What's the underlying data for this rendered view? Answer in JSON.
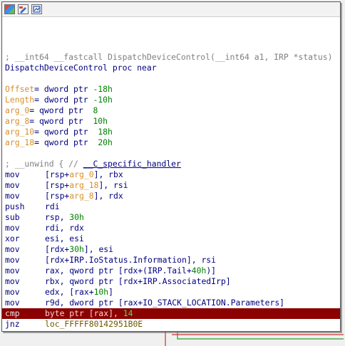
{
  "titlebar": {
    "icons": [
      "color-palette-icon",
      "edit-node-icon",
      "graph-overview-icon"
    ]
  },
  "header": {
    "comment": "; __int64 __fastcall DispatchDeviceControl(__int64 a1, IRP *status)",
    "proc_name": "DispatchDeviceControl",
    "proc_kw": " proc near"
  },
  "vars": [
    {
      "name": "Offset",
      "type": "= dword ptr ",
      "value": "-18h"
    },
    {
      "name": "Length",
      "type": "= dword ptr ",
      "value": "-10h"
    },
    {
      "name": "arg_0",
      "type": "= qword ptr  ",
      "value": "8"
    },
    {
      "name": "arg_8",
      "type": "= qword ptr  ",
      "value": "10h"
    },
    {
      "name": "arg_10",
      "type": "= qword ptr  ",
      "value": "18h"
    },
    {
      "name": "arg_18",
      "type": "= qword ptr  ",
      "value": "20h"
    }
  ],
  "unwind": {
    "prefix": "; __unwind { // ",
    "handler": "__C_specific_handler"
  },
  "instructions": [
    {
      "mn": "mov",
      "parts": [
        [
          "[rsp+",
          "kw"
        ],
        [
          "arg_0",
          "var"
        ],
        [
          "], rbx",
          "kw"
        ]
      ]
    },
    {
      "mn": "mov",
      "parts": [
        [
          "[rsp+",
          "kw"
        ],
        [
          "arg_18",
          "var"
        ],
        [
          "], rsi",
          "kw"
        ]
      ]
    },
    {
      "mn": "mov",
      "parts": [
        [
          "[rsp+",
          "kw"
        ],
        [
          "arg_8",
          "var"
        ],
        [
          "], rdx",
          "kw"
        ]
      ]
    },
    {
      "mn": "push",
      "parts": [
        [
          "rdi",
          "kw"
        ]
      ]
    },
    {
      "mn": "sub",
      "parts": [
        [
          "rsp, ",
          "kw"
        ],
        [
          "30h",
          "num"
        ]
      ]
    },
    {
      "mn": "mov",
      "parts": [
        [
          "rdi, rdx",
          "kw"
        ]
      ]
    },
    {
      "mn": "xor",
      "parts": [
        [
          "esi, esi",
          "kw"
        ]
      ]
    },
    {
      "mn": "mov",
      "parts": [
        [
          "[rdx+",
          "kw"
        ],
        [
          "30h",
          "num"
        ],
        [
          "], esi",
          "kw"
        ]
      ]
    },
    {
      "mn": "mov",
      "parts": [
        [
          "[rdx+IRP.IoStatus.Information], rsi",
          "kw"
        ]
      ]
    },
    {
      "mn": "mov",
      "parts": [
        [
          "rax, qword ptr [rdx+(IRP.Tail+",
          "kw"
        ],
        [
          "40h",
          "num"
        ],
        [
          ")]",
          "kw"
        ]
      ]
    },
    {
      "mn": "mov",
      "parts": [
        [
          "rbx, qword ptr [rdx+IRP.AssociatedIrp]",
          "kw"
        ]
      ]
    },
    {
      "mn": "mov",
      "parts": [
        [
          "edx, [rax+",
          "kw"
        ],
        [
          "10h",
          "num"
        ],
        [
          "]",
          "kw"
        ]
      ]
    },
    {
      "mn": "mov",
      "parts": [
        [
          "r9d, dword ptr [rax+IO_STACK_LOCATION.Parameters]",
          "kw"
        ]
      ]
    },
    {
      "mn": "cmp",
      "parts": [
        [
          "byte ptr [rax], ",
          "op"
        ],
        [
          "14",
          "num"
        ]
      ],
      "highlight": true
    },
    {
      "mn": "jnz",
      "parts": [
        [
          "loc_FFFFF80142951B0E",
          "loc"
        ]
      ]
    }
  ],
  "colors": {
    "highlight_row": "#8b0000",
    "edge_red": "#d03030",
    "edge_green": "#2f9a2f"
  }
}
